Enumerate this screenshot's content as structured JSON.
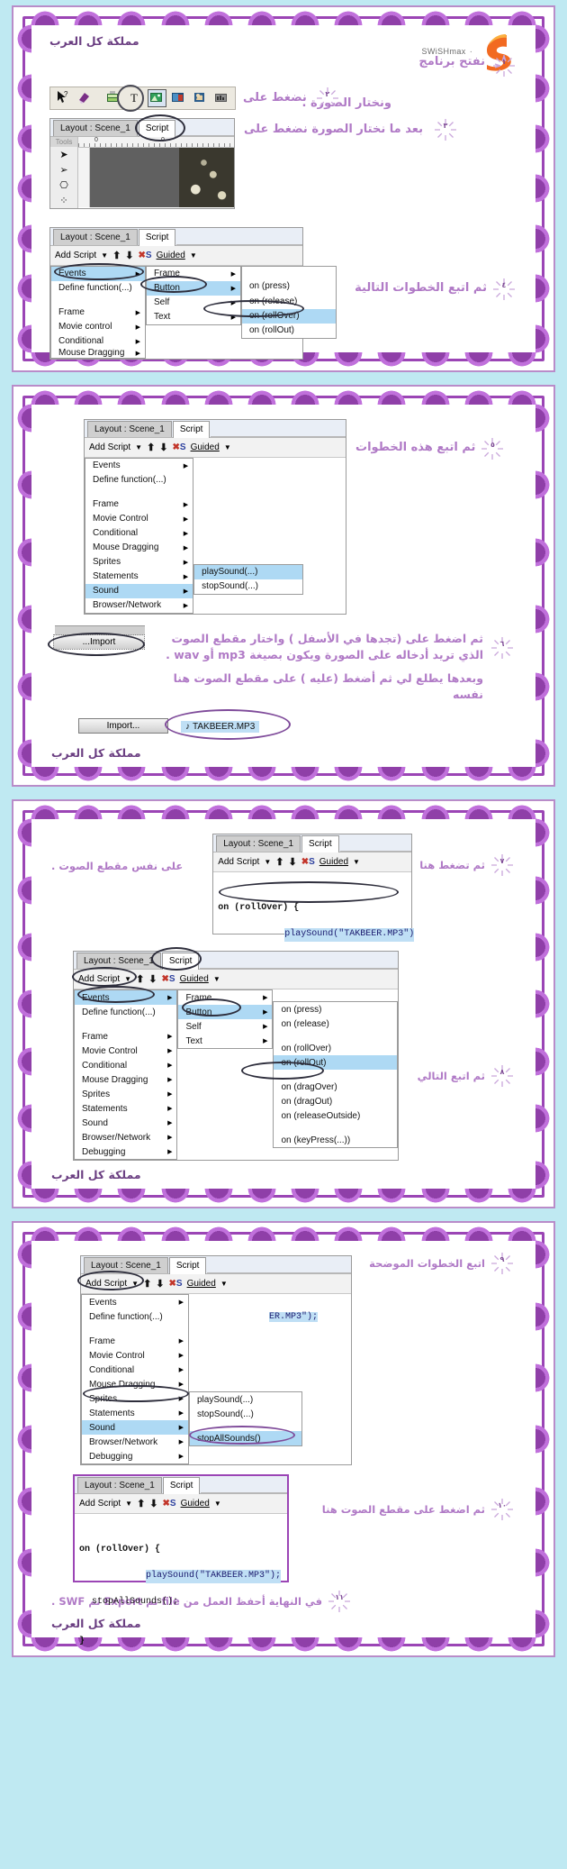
{
  "meta": {
    "brand": "مملكة كل العرب",
    "app_logo_text": "SWiSHmax",
    "accent_purple": "#9b45b5",
    "accent_text": "#b07ac6",
    "bg_blue": "#bfe9f2"
  },
  "panel1": {
    "brand": "مملكة كل العرب",
    "step1": {
      "num": "١",
      "text": "نفتح برنامج"
    },
    "step2": {
      "num": "٢",
      "text": "نضغط على",
      "text2": "ونختار الصورة ."
    },
    "step3": {
      "num": "٣",
      "text": "بعد ما نختار الصورة نضغط على"
    },
    "step4": {
      "num": "٤",
      "text": "ثم اتبع الخطوات التالية"
    },
    "toolbar_icons": [
      "arrow-help-icon",
      "eraser-icon",
      "insert-text-icon",
      "text-tool-icon",
      "insert-image-icon",
      "insert-button-icon",
      "insert-sprite-icon",
      "insert-scene-icon"
    ],
    "window": {
      "tabs": [
        "Layout : Scene_1",
        "Script"
      ],
      "active_tab": "Script",
      "tools_label": "Tools",
      "ruler_marks": [
        "0",
        "0"
      ],
      "script_bar": [
        "Add Script",
        "Guided"
      ],
      "menu_col1": [
        "Events",
        "Define function(...)",
        "Frame",
        "Movie control",
        "Conditional",
        "Mouse Dragging"
      ],
      "menu_col2": [
        "Frame",
        "Button",
        "Self",
        "Text"
      ],
      "menu_col3": [
        "on (press)",
        "on (release)",
        "on (rollOver)",
        "on (rollOut)"
      ],
      "highlighted": [
        "Events",
        "Button",
        "on (rollOver)"
      ]
    }
  },
  "panel2": {
    "brand": "مملكة كل العرب",
    "step5": {
      "num": "٥",
      "text": "ثم اتبع هذه الخطوات"
    },
    "step6": {
      "num": "٦",
      "line1": "ثم اضغط على (تجدها في الأسفل ) واختار مقطع الصوت",
      "line2": "الذي تريد أدخاله على الصورة ويكون بصيغة mp3 أو wav .",
      "line3": "وبعدها يطلع لي ثم أضغط (عليه ) على مقطع الصوت هنا نفسه"
    },
    "window": {
      "tabs": [
        "Layout : Scene_1",
        "Script"
      ],
      "active_tab": "Script",
      "script_bar": [
        "Add Script",
        "Guided"
      ],
      "menu_col1": [
        "Events",
        "Define function(...)",
        "Frame",
        "Movie Control",
        "Conditional",
        "Mouse Dragging",
        "Sprites",
        "Statements",
        "Sound",
        "Browser/Network"
      ],
      "menu_col2": [
        "playSound(...)",
        "stopSound(...)"
      ],
      "highlighted": [
        "Sound",
        "playSound(...)"
      ]
    },
    "import_button": "Import...",
    "import_button_top": "Import...",
    "sound_file": "TAKBEER.MP3",
    "note_icon": "music-note-icon"
  },
  "panel3": {
    "brand": "مملكة كل العرب",
    "step7": {
      "num": "٧",
      "text": "ثم تضغط هنا",
      "text2": "على نفس مقطع الصوت ."
    },
    "step8": {
      "num": "٨",
      "text": "ثم اتبع التالي"
    },
    "window_a": {
      "tabs": [
        "Layout : Scene_1",
        "Script"
      ],
      "active_tab": "Script",
      "script_bar": [
        "Add Script",
        "Guided"
      ],
      "code_lines": [
        "on (rollOver) {",
        "playSound(\"TAKBEER.MP3\")",
        "}"
      ]
    },
    "window_b": {
      "tabs": [
        "Layout : Scene_1",
        "Script"
      ],
      "active_tab": "Script",
      "script_bar": [
        "Add Script",
        "Guided"
      ],
      "menu_col1": [
        "Events",
        "Define function(...)",
        "Frame",
        "Movie Control",
        "Conditional",
        "Mouse Dragging",
        "Sprites",
        "Statements",
        "Sound",
        "Browser/Network",
        "Debugging"
      ],
      "menu_col2": [
        "Frame",
        "Button",
        "Self",
        "Text"
      ],
      "menu_col3": [
        "on (press)",
        "on (release)",
        "on (rollOver)",
        "on (rollOut)",
        "on (dragOver)",
        "on (dragOut)",
        "on (releaseOutside)",
        "on (keyPress(...))"
      ],
      "highlighted": [
        "Events",
        "Button",
        "on (rollOut)"
      ]
    }
  },
  "panel4": {
    "brand": "مملكة كل العرب",
    "step9": {
      "num": "٩",
      "text": "اتبع الخطوات الموضحة"
    },
    "step10": {
      "num": "١٠",
      "text": "ثم اضغط على مقطع الصوت هنا"
    },
    "step11": {
      "num": "١١",
      "text": "في النهاية أحفظ العمل من file ثم Export ثم SWF ."
    },
    "window_a": {
      "tabs": [
        "Layout : Scene_1",
        "Script"
      ],
      "active_tab": "Script",
      "script_bar": [
        "Add Script",
        "Guided"
      ],
      "menu_col1": [
        "Events",
        "Define function(...)",
        "Frame",
        "Movie Control",
        "Conditional",
        "Mouse Dragging",
        "Sprites",
        "Statements",
        "Sound",
        "Browser/Network",
        "Debugging"
      ],
      "menu_col2": [
        "playSound(...)",
        "stopSound(...)",
        "stopAllSounds()"
      ],
      "highlighted": [
        "Sound",
        "stopAllSounds()"
      ],
      "code_fragment": "ER.MP3\");"
    },
    "window_b": {
      "tabs": [
        "Layout : Scene_1",
        "Script"
      ],
      "active_tab": "Script",
      "script_bar": [
        "Add Script",
        "Guided"
      ],
      "code_lines": [
        "on (rollOver) {",
        "playSound(\"TAKBEER.MP3\");",
        "stopAllSounds();",
        "}"
      ]
    }
  }
}
